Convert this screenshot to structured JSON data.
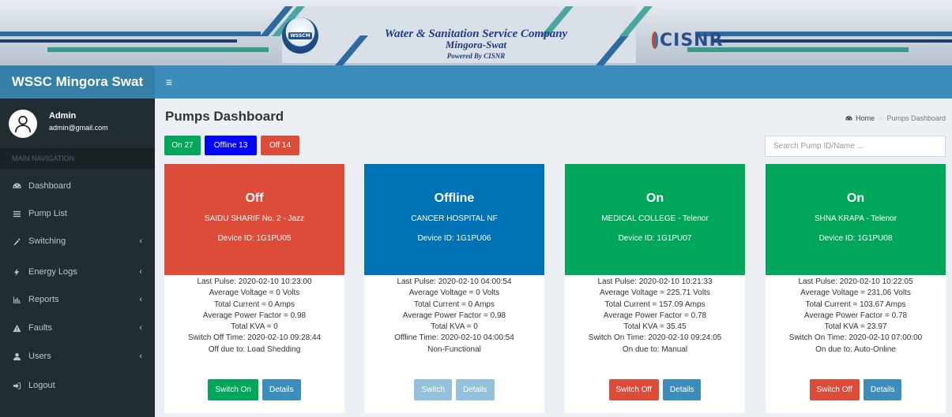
{
  "banner": {
    "logo_text": "WSSCM",
    "title": "Water & Sanitation Service Company",
    "subtitle": "Mingora-Swat",
    "powered": "Powered By CISNR",
    "partner_logo": "CISNR"
  },
  "navbar": {
    "brand": "WSSC Mingora Swat",
    "menu_icon": "hamburger-icon"
  },
  "user": {
    "name": "Admin",
    "email": "admin@gmail.com"
  },
  "sidebar": {
    "header": "MAIN NAVIGATION",
    "items": [
      {
        "label": "Dashboard",
        "icon": "dashboard-icon",
        "has_submenu": false
      },
      {
        "label": "Pump List",
        "icon": "list-icon",
        "has_submenu": false
      },
      {
        "label": "Switching",
        "icon": "switch-icon",
        "has_submenu": true
      },
      {
        "label": "Energy Logs",
        "icon": "bolt-icon",
        "has_submenu": true
      },
      {
        "label": "Reports",
        "icon": "bar-chart-icon",
        "has_submenu": true
      },
      {
        "label": "Faults",
        "icon": "warning-icon",
        "has_submenu": true
      },
      {
        "label": "Users",
        "icon": "user-icon",
        "has_submenu": true
      },
      {
        "label": "Logout",
        "icon": "logout-icon",
        "has_submenu": false
      }
    ],
    "chevron": "‹"
  },
  "page": {
    "title": "Pumps Dashboard",
    "breadcrumb": {
      "home": "Home",
      "current": "Pumps Dashboard"
    },
    "search_placeholder": "Search Pump ID/Name ..."
  },
  "filters": [
    {
      "label": "On 27",
      "color": "#00a65a"
    },
    {
      "label": "Offline 13",
      "color": "#0000ff"
    },
    {
      "label": "Off 14",
      "color": "#dd4b39"
    }
  ],
  "colors": {
    "off": "#dd4b39",
    "offline": "#0073b7",
    "on": "#00a65a",
    "info": "#3c8dbc"
  },
  "pumps": [
    {
      "status": "Off",
      "status_color": "#dd4b39",
      "name": "SAIDU SHARIF No. 2 - Jazz",
      "device": "Device ID: 1G1PU05",
      "details": [
        "Last Pulse: 2020-02-10 10:23:00",
        "Average Voltage = 0 Volts",
        "Total Current = 0 Amps",
        "Average Power Factor = 0.98",
        "Total KVA = 0",
        "Switch Off Time: 2020-02-10 09:28:44",
        "Off due to: Load Shedding"
      ],
      "action_label": "Switch On",
      "action_color": "#00a65a",
      "action_enabled": true,
      "details_label": "Details",
      "details_enabled": true
    },
    {
      "status": "Offline",
      "status_color": "#0073b7",
      "name": "CANCER HOSPITAL NF",
      "device": "Device ID: 1G1PU06",
      "details": [
        "Last Pulse: 2020-02-10 04:00:54",
        "Average Voltage = 0 Volts",
        "Total Current = 0 Amps",
        "Average Power Factor = 0.98",
        "Total KVA = 0",
        "Offline Time: 2020-02-10 04:00:54",
        "Non-Functional"
      ],
      "action_label": "Switch",
      "action_color": "#3c8dbc",
      "action_enabled": false,
      "details_label": "Details",
      "details_enabled": false
    },
    {
      "status": "On",
      "status_color": "#00a65a",
      "name": "MEDICAL COLLEGE - Telenor",
      "device": "Device ID: 1G1PU07",
      "details": [
        "Last Pulse: 2020-02-10 10:21:33",
        "Average Voltage = 225.71 Volts",
        "Total Current = 157.09 Amps",
        "Average Power Factor = 0.78",
        "Total KVA = 35.45",
        "Switch On Time: 2020-02-10 09:24:05",
        "On due to: Manual"
      ],
      "action_label": "Switch Off",
      "action_color": "#dd4b39",
      "action_enabled": true,
      "details_label": "Details",
      "details_enabled": true
    },
    {
      "status": "On",
      "status_color": "#00a65a",
      "name": "SHNA KRAPA - Telenor",
      "device": "Device ID: 1G1PU08",
      "details": [
        "Last Pulse: 2020-02-10 10:22:05",
        "Average Voltage = 231.06 Volts",
        "Total Current = 103.67 Amps",
        "Average Power Factor = 0.78",
        "Total KVA = 23.97",
        "Switch On Time: 2020-02-10 07:00:00",
        "On due to: Auto-Online"
      ],
      "action_label": "Switch Off",
      "action_color": "#dd4b39",
      "action_enabled": true,
      "details_label": "Details",
      "details_enabled": true
    }
  ]
}
